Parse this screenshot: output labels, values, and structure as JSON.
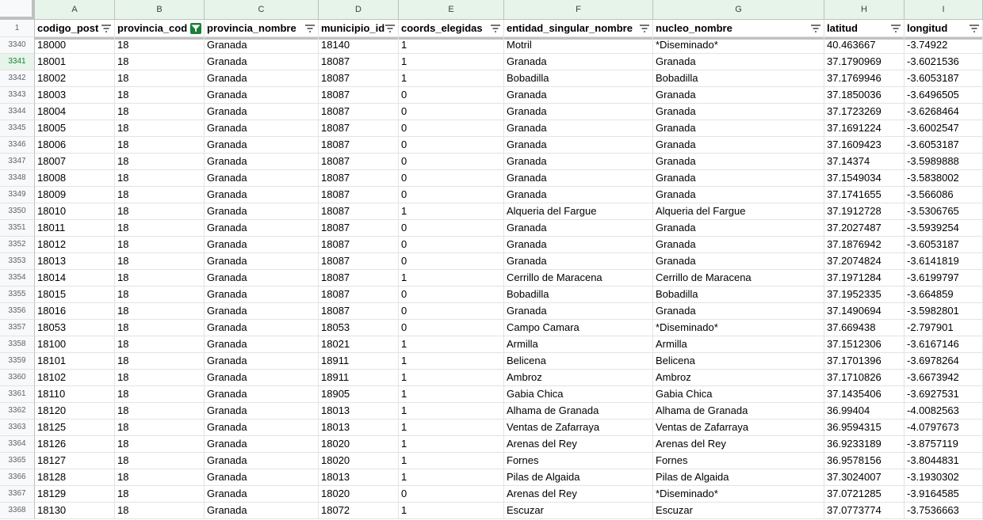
{
  "sheet": {
    "columns": [
      "A",
      "B",
      "C",
      "D",
      "E",
      "F",
      "G",
      "H",
      "I"
    ],
    "header_row_number": "1",
    "headers": [
      "codigo_post",
      "provincia_cod",
      "provincia_nombre",
      "municipio_id",
      "coords_elegidas",
      "entidad_singular_nombre",
      "nucleo_nombre",
      "latitud",
      "longitud"
    ],
    "active_filter_column": 1,
    "selected_row_number": "3341",
    "rows": [
      {
        "n": "3340",
        "c": [
          "18000",
          "18",
          "Granada",
          "18140",
          "1",
          "Motril",
          "*Diseminado*",
          "40.463667",
          "-3.74922"
        ]
      },
      {
        "n": "3341",
        "c": [
          "18001",
          "18",
          "Granada",
          "18087",
          "1",
          "Granada",
          "Granada",
          "37.1790969",
          "-3.6021536"
        ]
      },
      {
        "n": "3342",
        "c": [
          "18002",
          "18",
          "Granada",
          "18087",
          "1",
          "Bobadilla",
          "Bobadilla",
          "37.1769946",
          "-3.6053187"
        ]
      },
      {
        "n": "3343",
        "c": [
          "18003",
          "18",
          "Granada",
          "18087",
          "0",
          "Granada",
          "Granada",
          "37.1850036",
          "-3.6496505"
        ]
      },
      {
        "n": "3344",
        "c": [
          "18004",
          "18",
          "Granada",
          "18087",
          "0",
          "Granada",
          "Granada",
          "37.1723269",
          "-3.6268464"
        ]
      },
      {
        "n": "3345",
        "c": [
          "18005",
          "18",
          "Granada",
          "18087",
          "0",
          "Granada",
          "Granada",
          "37.1691224",
          "-3.6002547"
        ]
      },
      {
        "n": "3346",
        "c": [
          "18006",
          "18",
          "Granada",
          "18087",
          "0",
          "Granada",
          "Granada",
          "37.1609423",
          "-3.6053187"
        ]
      },
      {
        "n": "3347",
        "c": [
          "18007",
          "18",
          "Granada",
          "18087",
          "0",
          "Granada",
          "Granada",
          "37.14374",
          "-3.5989888"
        ]
      },
      {
        "n": "3348",
        "c": [
          "18008",
          "18",
          "Granada",
          "18087",
          "0",
          "Granada",
          "Granada",
          "37.1549034",
          "-3.5838002"
        ]
      },
      {
        "n": "3349",
        "c": [
          "18009",
          "18",
          "Granada",
          "18087",
          "0",
          "Granada",
          "Granada",
          "37.1741655",
          "-3.566086"
        ]
      },
      {
        "n": "3350",
        "c": [
          "18010",
          "18",
          "Granada",
          "18087",
          "1",
          "Alqueria del Fargue",
          "Alqueria del Fargue",
          "37.1912728",
          "-3.5306765"
        ]
      },
      {
        "n": "3351",
        "c": [
          "18011",
          "18",
          "Granada",
          "18087",
          "0",
          "Granada",
          "Granada",
          "37.2027487",
          "-3.5939254"
        ]
      },
      {
        "n": "3352",
        "c": [
          "18012",
          "18",
          "Granada",
          "18087",
          "0",
          "Granada",
          "Granada",
          "37.1876942",
          "-3.6053187"
        ]
      },
      {
        "n": "3353",
        "c": [
          "18013",
          "18",
          "Granada",
          "18087",
          "0",
          "Granada",
          "Granada",
          "37.2074824",
          "-3.6141819"
        ]
      },
      {
        "n": "3354",
        "c": [
          "18014",
          "18",
          "Granada",
          "18087",
          "1",
          "Cerrillo de Maracena",
          "Cerrillo de Maracena",
          "37.1971284",
          "-3.6199797"
        ]
      },
      {
        "n": "3355",
        "c": [
          "18015",
          "18",
          "Granada",
          "18087",
          "0",
          "Bobadilla",
          "Bobadilla",
          "37.1952335",
          "-3.664859"
        ]
      },
      {
        "n": "3356",
        "c": [
          "18016",
          "18",
          "Granada",
          "18087",
          "0",
          "Granada",
          "Granada",
          "37.1490694",
          "-3.5982801"
        ]
      },
      {
        "n": "3357",
        "c": [
          "18053",
          "18",
          "Granada",
          "18053",
          "0",
          "Campo Camara",
          "*Diseminado*",
          "37.669438",
          "-2.797901"
        ]
      },
      {
        "n": "3358",
        "c": [
          "18100",
          "18",
          "Granada",
          "18021",
          "1",
          "Armilla",
          "Armilla",
          "37.1512306",
          "-3.6167146"
        ]
      },
      {
        "n": "3359",
        "c": [
          "18101",
          "18",
          "Granada",
          "18911",
          "1",
          "Belicena",
          "Belicena",
          "37.1701396",
          "-3.6978264"
        ]
      },
      {
        "n": "3360",
        "c": [
          "18102",
          "18",
          "Granada",
          "18911",
          "1",
          "Ambroz",
          "Ambroz",
          "37.1710826",
          "-3.6673942"
        ]
      },
      {
        "n": "3361",
        "c": [
          "18110",
          "18",
          "Granada",
          "18905",
          "1",
          "Gabia Chica",
          "Gabia Chica",
          "37.1435406",
          "-3.6927531"
        ]
      },
      {
        "n": "3362",
        "c": [
          "18120",
          "18",
          "Granada",
          "18013",
          "1",
          "Alhama de Granada",
          "Alhama de Granada",
          "36.99404",
          "-4.0082563"
        ]
      },
      {
        "n": "3363",
        "c": [
          "18125",
          "18",
          "Granada",
          "18013",
          "1",
          "Ventas de Zafarraya",
          "Ventas de Zafarraya",
          "36.9594315",
          "-4.0797673"
        ]
      },
      {
        "n": "3364",
        "c": [
          "18126",
          "18",
          "Granada",
          "18020",
          "1",
          "Arenas del Rey",
          "Arenas del Rey",
          "36.9233189",
          "-3.8757119"
        ]
      },
      {
        "n": "3365",
        "c": [
          "18127",
          "18",
          "Granada",
          "18020",
          "1",
          "Fornes",
          "Fornes",
          "36.9578156",
          "-3.8044831"
        ]
      },
      {
        "n": "3366",
        "c": [
          "18128",
          "18",
          "Granada",
          "18013",
          "1",
          "Pilas de Algaida",
          "Pilas de Algaida",
          "37.3024007",
          "-3.1930302"
        ]
      },
      {
        "n": "3367",
        "c": [
          "18129",
          "18",
          "Granada",
          "18020",
          "0",
          "Arenas del Rey",
          "*Diseminado*",
          "37.0721285",
          "-3.9164585"
        ]
      },
      {
        "n": "3368",
        "c": [
          "18130",
          "18",
          "Granada",
          "18072",
          "1",
          "Escuzar",
          "Escuzar",
          "37.0773774",
          "-3.7536663"
        ]
      }
    ]
  }
}
